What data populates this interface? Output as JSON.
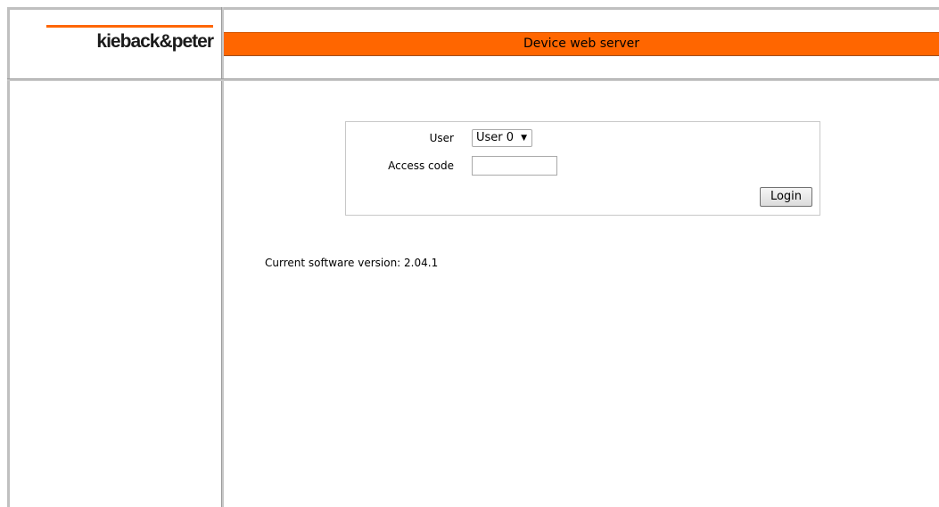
{
  "brand": {
    "logo_text": "kieback&peter",
    "accent_color": "#ff6600"
  },
  "header": {
    "title": "Device web server"
  },
  "login": {
    "user_label": "User",
    "user_selected": "User 0",
    "access_code_label": "Access code",
    "access_code_value": "",
    "login_button": "Login"
  },
  "footer": {
    "version_text": "Current software version: 2.04.1"
  }
}
